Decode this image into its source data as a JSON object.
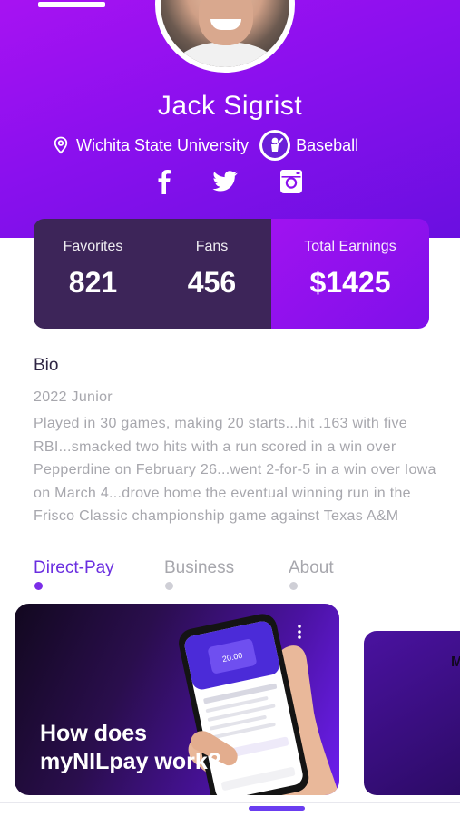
{
  "profile": {
    "name": "Jack Sigrist",
    "school": "Wichita State University",
    "sport": "Baseball"
  },
  "socials": [
    "facebook-icon",
    "twitter-icon",
    "instagram-icon"
  ],
  "stats": {
    "favorites_label": "Favorites",
    "favorites_value": "821",
    "fans_label": "Fans",
    "fans_value": "456",
    "earnings_label": "Total Earnings",
    "earnings_value": "$1425"
  },
  "bio": {
    "title": "Bio",
    "year": "2022 Junior",
    "text": "Played in 30 games, making 20 starts...hit .163 with five RBI...smacked two hits with a run scored in a win over Pepperdine on February 26...went 2-for-5 in a win over Iowa on March 4...drove home the eventual winning run in the Frisco Classic championship game against Texas A&M"
  },
  "tabs": [
    {
      "label": "Direct-Pay",
      "active": true
    },
    {
      "label": "Business",
      "active": false
    },
    {
      "label": "About",
      "active": false
    }
  ],
  "cards": {
    "main_title_line1": "How does",
    "main_title_line2": "myNILpay work?",
    "peek_text": "M"
  },
  "colors": {
    "primary": "#8a10ee",
    "stats_dark": "#3d2559",
    "active_tab": "#6a2ee0",
    "inactive_tab": "#a7a7ad",
    "text_gray": "#a7a7ad"
  }
}
